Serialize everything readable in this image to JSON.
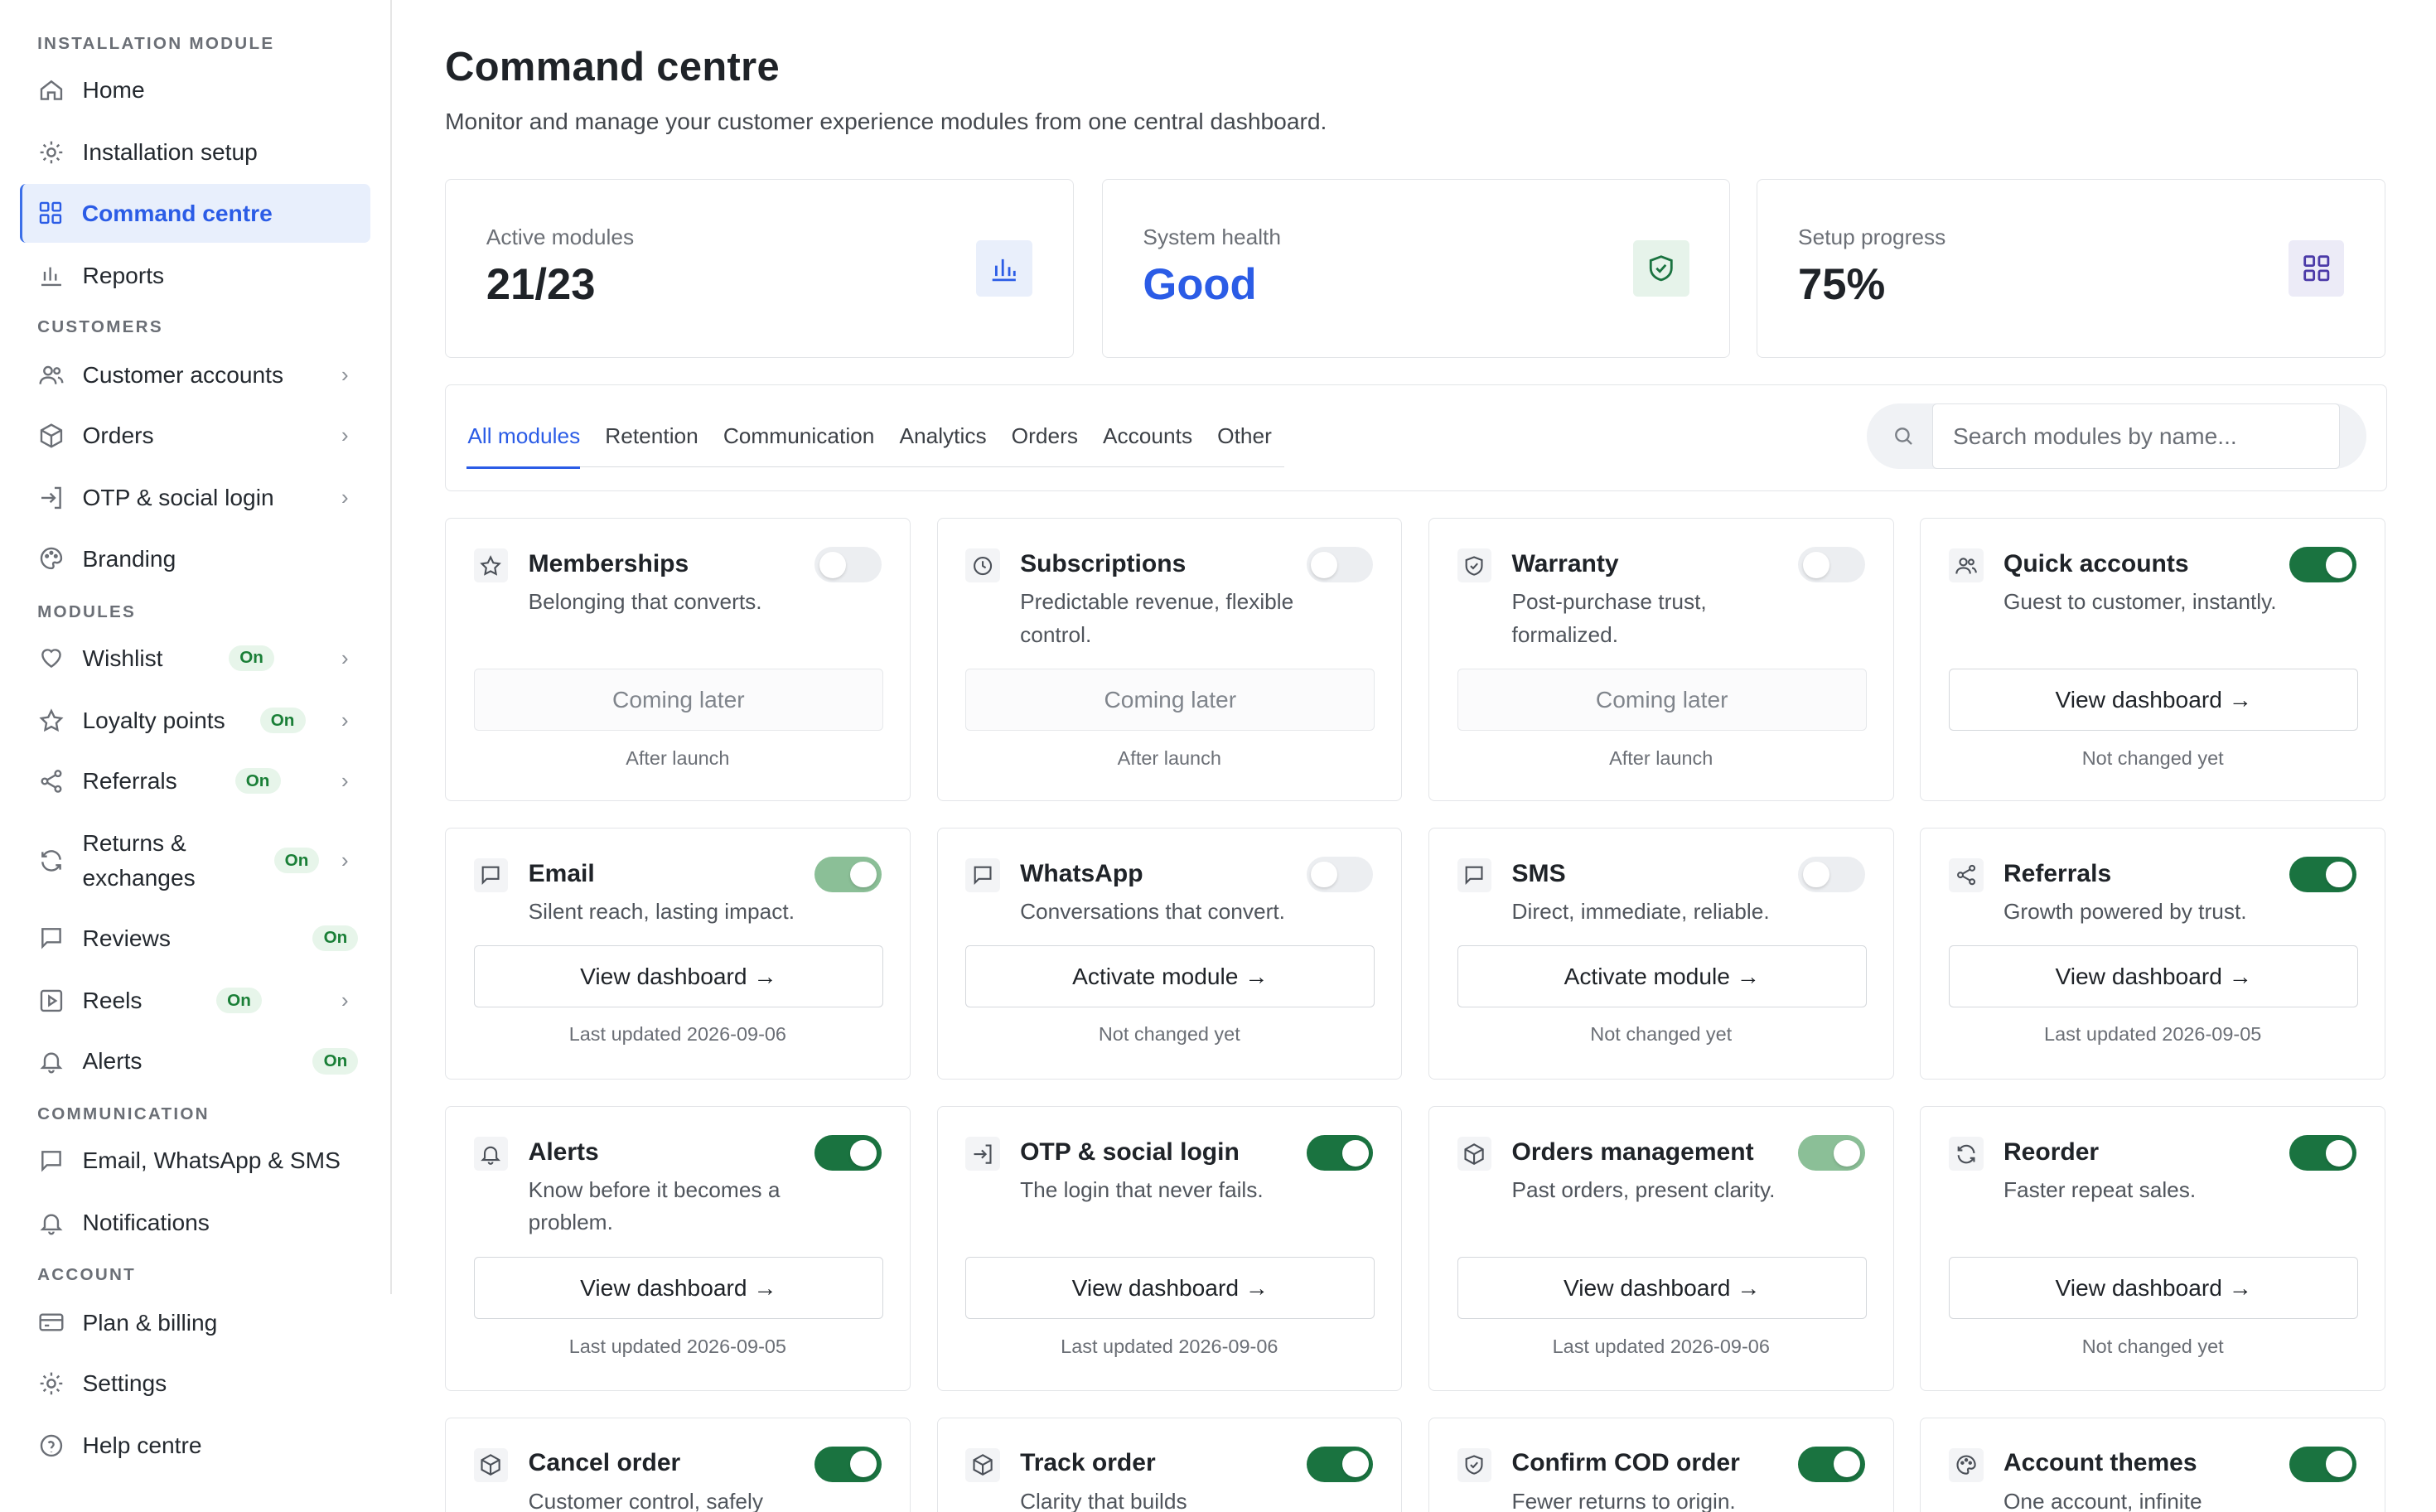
{
  "sidebar": {
    "sections": [
      {
        "title": "INSTALLATION MODULE"
      },
      {
        "title": "CUSTOMERS"
      },
      {
        "title": "MODULES"
      },
      {
        "title": "COMMUNICATION"
      },
      {
        "title": "ACCOUNT"
      }
    ],
    "items": [
      {
        "label": "Home",
        "icon": "home-icon"
      },
      {
        "label": "Installation setup",
        "icon": "gear-icon"
      },
      {
        "label": "Command centre",
        "icon": "grid-icon",
        "active": true
      },
      {
        "label": "Reports",
        "icon": "bar-chart-icon"
      },
      {
        "label": "Customer accounts",
        "icon": "users-icon"
      },
      {
        "label": "Orders",
        "icon": "box-icon"
      },
      {
        "label": "OTP & social login",
        "icon": "login-icon"
      },
      {
        "label": "Branding",
        "icon": "palette-icon"
      },
      {
        "label": "Wishlist",
        "icon": "heart-icon",
        "badge": "On"
      },
      {
        "label": "Loyalty points",
        "icon": "star-icon",
        "badge": "On"
      },
      {
        "label": "Referrals",
        "icon": "share-icon",
        "badge": "On"
      },
      {
        "label": "Returns & exchanges",
        "icon": "refresh-icon",
        "badge": "On"
      },
      {
        "label": "Reviews",
        "icon": "message-icon",
        "badge": "On"
      },
      {
        "label": "Reels",
        "icon": "play-icon",
        "badge": "On"
      },
      {
        "label": "Alerts",
        "icon": "bell-icon",
        "badge": "On"
      },
      {
        "label": "Email, WhatsApp & SMS",
        "icon": "message-icon"
      },
      {
        "label": "Notifications",
        "icon": "bell-icon"
      },
      {
        "label": "Plan & billing",
        "icon": "card-icon"
      },
      {
        "label": "Settings",
        "icon": "gear-icon"
      },
      {
        "label": "Help centre",
        "icon": "help-icon"
      }
    ]
  },
  "header": {
    "title": "Command centre",
    "subtitle": "Monitor and manage your customer experience modules from one central dashboard."
  },
  "stats": [
    {
      "label": "Active modules",
      "value": "21/23",
      "icon": "bar-chart-icon"
    },
    {
      "label": "System health",
      "value": "Good",
      "icon": "shield-check-icon"
    },
    {
      "label": "Setup progress",
      "value": "75%",
      "icon": "grid-icon"
    }
  ],
  "tabs": [
    "All modules",
    "Retention",
    "Communication",
    "Analytics",
    "Orders",
    "Accounts",
    "Other"
  ],
  "search": {
    "placeholder": "Search modules by name..."
  },
  "modules": [
    {
      "title": "Memberships",
      "desc": "Belonging that converts.",
      "toggle": "off",
      "action": "Coming later",
      "foot": "After launch",
      "icon": "star-icon"
    },
    {
      "title": "Subscriptions",
      "desc": "Predictable revenue, flexible control.",
      "toggle": "off",
      "action": "Coming later",
      "foot": "After launch",
      "icon": "clock-icon"
    },
    {
      "title": "Warranty",
      "desc": "Post-purchase trust, formalized.",
      "toggle": "off",
      "action": "Coming later",
      "foot": "After launch",
      "icon": "shield-icon"
    },
    {
      "title": "Quick accounts",
      "desc": "Guest to customer, instantly.",
      "toggle": "on",
      "action": "View dashboard →",
      "foot": "Not changed yet",
      "icon": "users-icon"
    },
    {
      "title": "Email",
      "desc": "Silent reach, lasting impact.",
      "toggle": "dim",
      "action": "View dashboard →",
      "foot": "Last updated 2026-09-06",
      "icon": "message-icon"
    },
    {
      "title": "WhatsApp",
      "desc": "Conversations that convert.",
      "toggle": "off",
      "action": "Activate module →",
      "foot": "Not changed yet",
      "icon": "message-icon"
    },
    {
      "title": "SMS",
      "desc": "Direct, immediate, reliable.",
      "toggle": "off",
      "action": "Activate module →",
      "foot": "Not changed yet",
      "icon": "message-icon"
    },
    {
      "title": "Referrals",
      "desc": "Growth powered by trust.",
      "toggle": "on",
      "action": "View dashboard →",
      "foot": "Last updated 2026-09-05",
      "icon": "share-icon"
    },
    {
      "title": "Alerts",
      "desc": "Know before it becomes a problem.",
      "toggle": "on",
      "action": "View dashboard →",
      "foot": "Last updated 2026-09-05",
      "icon": "bell-icon"
    },
    {
      "title": "OTP & social login",
      "desc": "The login that never fails.",
      "toggle": "on",
      "action": "View dashboard →",
      "foot": "Last updated 2026-09-06",
      "icon": "login-icon"
    },
    {
      "title": "Orders management",
      "desc": "Past orders, present clarity.",
      "toggle": "dim",
      "action": "View dashboard →",
      "foot": "Last updated 2026-09-06",
      "icon": "box-icon"
    },
    {
      "title": "Reorder",
      "desc": "Faster repeat sales.",
      "toggle": "on",
      "action": "View dashboard →",
      "foot": "Not changed yet",
      "icon": "refresh-icon"
    },
    {
      "title": "Cancel order",
      "desc": "Customer control, safely",
      "toggle": "on",
      "icon": "box-icon"
    },
    {
      "title": "Track order",
      "desc": "Clarity that builds",
      "toggle": "on",
      "icon": "box-icon"
    },
    {
      "title": "Confirm COD order",
      "desc": "Fewer returns to origin.",
      "toggle": "on",
      "icon": "shield-icon"
    },
    {
      "title": "Account themes",
      "desc": "One account, infinite",
      "toggle": "on",
      "icon": "palette-icon"
    }
  ],
  "colors": {
    "accent": "#2b5ce6",
    "toggle_on": "#1a7340",
    "toggle_dim": "#8bbf97",
    "badge_green": "#1a7f37"
  }
}
